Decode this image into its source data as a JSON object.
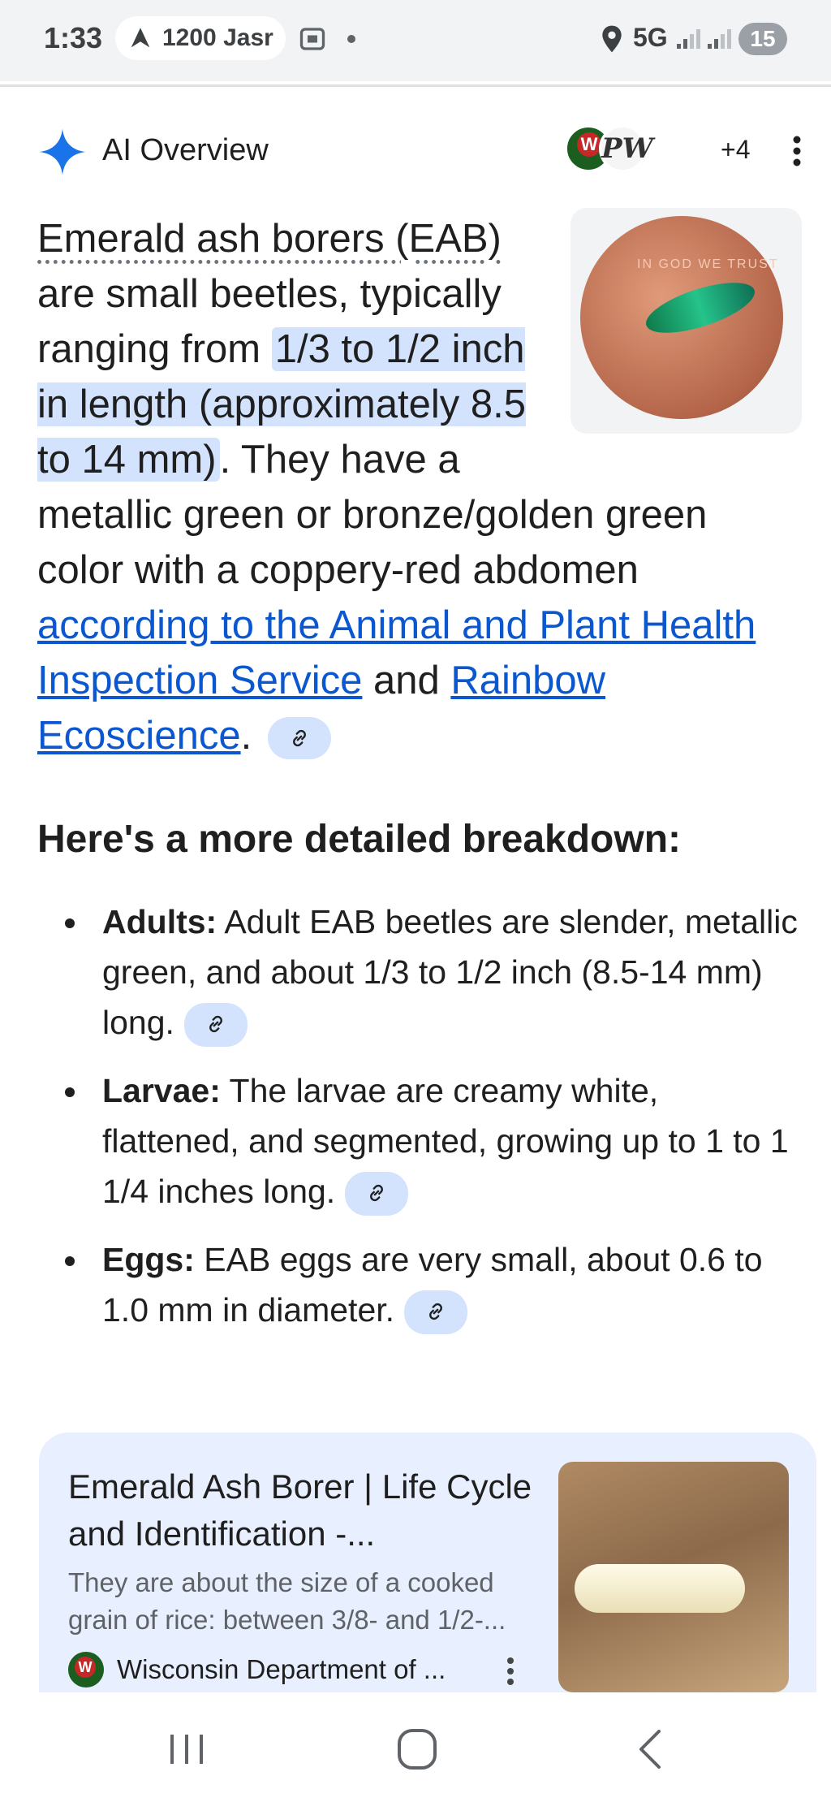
{
  "status_bar": {
    "time": "1:33",
    "location_text": "1200 Jasr",
    "network": "5G",
    "battery": "15"
  },
  "ai_overview": {
    "title": "AI Overview",
    "more_sources": "+4",
    "sparkle_color": "#1a73e8"
  },
  "intro": {
    "term": "Emerald ash borers (EAB)",
    "text1": " are small beetles, typically ranging from ",
    "highlight": "1/3 to 1/2 inch in length (approximately 8.5 to 14 mm)",
    "text2": ". They have a metallic green or bronze/golden green color with a coppery-red abdomen ",
    "link1": "according to the Animal and Plant Health Inspection Service",
    "text3": " and ",
    "link2": "Rainbow Ecoscience",
    "text4": "."
  },
  "breakdown": {
    "title": "Here's a more detailed breakdown:",
    "items": [
      {
        "label": "Adults:",
        "text": " Adult EAB beetles are slender, metallic green, and about 1/3 to 1/2 inch (8.5-14 mm) long."
      },
      {
        "label": "Larvae:",
        "text": " The larvae are creamy white, flattened, and segmented, growing up to 1 to 1 1/4 inches long."
      },
      {
        "label": "Eggs:",
        "text": " EAB eggs are very small, about 0.6 to 1.0 mm in diameter."
      }
    ]
  },
  "source_card": {
    "title": "Emerald Ash Borer | Life Cycle and Identification -...",
    "snippet": "They are about the size of a cooked grain of rice: between 3/8- and 1/2-...",
    "source": "Wisconsin Department of ..."
  },
  "colors": {
    "highlight": "#d3e3fd",
    "link": "#0b57d0",
    "card_bg": "#e8effe"
  }
}
